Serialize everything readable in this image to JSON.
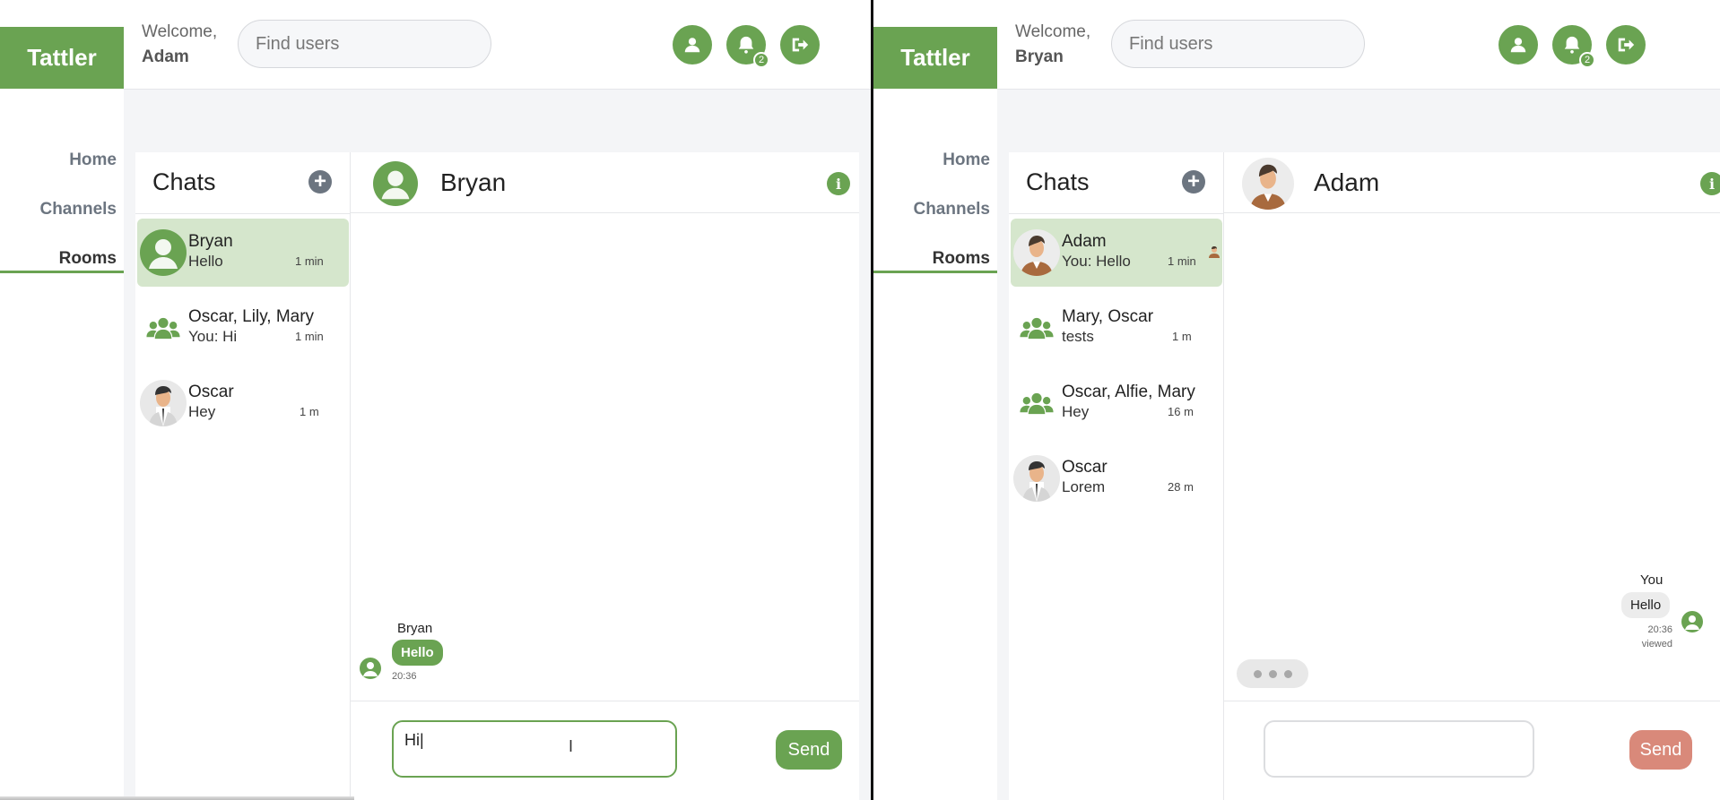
{
  "left": {
    "brand": "Tattler",
    "nav": {
      "home": "Home",
      "channels": "Channels",
      "rooms": "Rooms"
    },
    "welcome": {
      "greeting": "Welcome,",
      "user": "Adam"
    },
    "search_placeholder": "Find users",
    "notification_count": "2",
    "chats_title": "Chats",
    "chat_list": [
      {
        "name": "Bryan",
        "last_message": "Hello",
        "time": "1 min",
        "avatar": "default-user-icon",
        "selected": true
      },
      {
        "name": "Oscar, Lily, Mary",
        "last_message": "You: Hi",
        "time": "1 min",
        "avatar": "group-icon"
      },
      {
        "name": "Oscar",
        "last_message": "Hey",
        "time": "1 m",
        "avatar": "oscar-avatar"
      }
    ],
    "conversation": {
      "title": "Bryan",
      "messages": [
        {
          "sender": "Bryan",
          "text": "Hello",
          "time": "20:36"
        }
      ],
      "input_value": "Hi",
      "send_label": "Send"
    }
  },
  "right": {
    "brand": "Tattler",
    "nav": {
      "home": "Home",
      "channels": "Channels",
      "rooms": "Rooms"
    },
    "welcome": {
      "greeting": "Welcome,",
      "user": "Bryan"
    },
    "search_placeholder": "Find users",
    "notification_count": "2",
    "chats_title": "Chats",
    "chat_list": [
      {
        "name": "Adam",
        "last_message": "You: Hello",
        "time": "1 min",
        "avatar": "adam-avatar",
        "selected": true
      },
      {
        "name": "Mary, Oscar",
        "last_message": "tests",
        "time": "1 m",
        "avatar": "group-icon"
      },
      {
        "name": "Oscar, Alfie, Mary",
        "last_message": "Hey",
        "time": "16 m",
        "avatar": "group-icon"
      },
      {
        "name": "Oscar",
        "last_message": "Lorem",
        "time": "28 m",
        "avatar": "oscar-avatar"
      }
    ],
    "conversation": {
      "title": "Adam",
      "messages": [
        {
          "sender": "You",
          "text": "Hello",
          "time": "20:36",
          "status": "viewed"
        }
      ],
      "input_value": "",
      "send_label": "Send"
    }
  },
  "colors": {
    "accent": "#6aa352",
    "selected_row": "#d5e6cc",
    "send_disabled": "#d9897a",
    "muted": "#6c7580"
  }
}
